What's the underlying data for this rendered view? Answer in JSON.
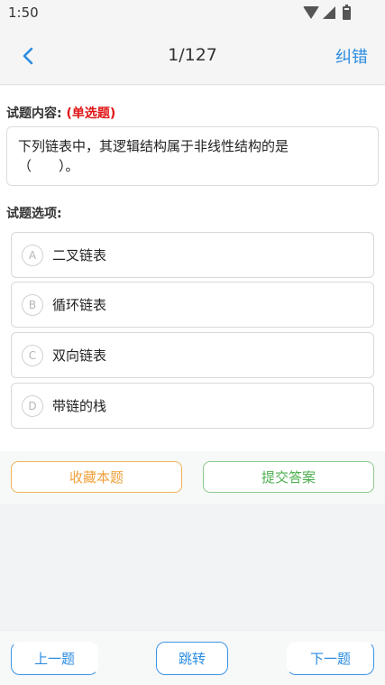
{
  "status_bar": {
    "time": "1:50",
    "icons": [
      "wifi-icon",
      "signal-icon",
      "battery-icon"
    ]
  },
  "header": {
    "back_icon": "chevron-left-icon",
    "progress": "1/127",
    "report_label": "纠错"
  },
  "question": {
    "content_label": "试题内容:",
    "type_tag": "(单选题)",
    "text_line1": "下列链表中，其逻辑结构属于非线性结构的是",
    "text_line2": "（　　）。",
    "options_label": "试题选项:",
    "options": [
      {
        "letter": "A",
        "text": "二叉链表"
      },
      {
        "letter": "B",
        "text": "循环链表"
      },
      {
        "letter": "C",
        "text": "双向链表"
      },
      {
        "letter": "D",
        "text": "带链的栈"
      }
    ]
  },
  "actions": {
    "favorite_label": "收藏本题",
    "submit_label": "提交答案"
  },
  "bottom_nav": {
    "prev_label": "上一题",
    "jump_label": "跳转",
    "next_label": "下一题"
  },
  "colors": {
    "accent_blue": "#2b8ce0",
    "type_red": "#e01515",
    "favorite_orange": "#f0a13a",
    "submit_green": "#4caf50"
  }
}
